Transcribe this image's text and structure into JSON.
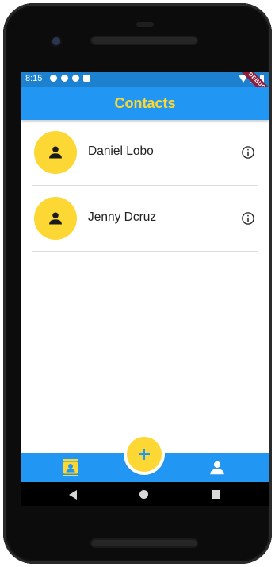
{
  "status_bar": {
    "time": "8:15",
    "debug_banner": "DEBUG"
  },
  "app_bar": {
    "title": "Contacts"
  },
  "contacts": [
    {
      "name": "Daniel Lobo"
    },
    {
      "name": "Jenny Dcruz"
    }
  ],
  "fab": {
    "label": "+"
  },
  "bottom_nav": {
    "items": [
      "contacts-icon",
      "person-icon"
    ]
  },
  "colors": {
    "primary": "#2196F3",
    "accent": "#FDD835",
    "status_bar": "#1D81D0"
  }
}
